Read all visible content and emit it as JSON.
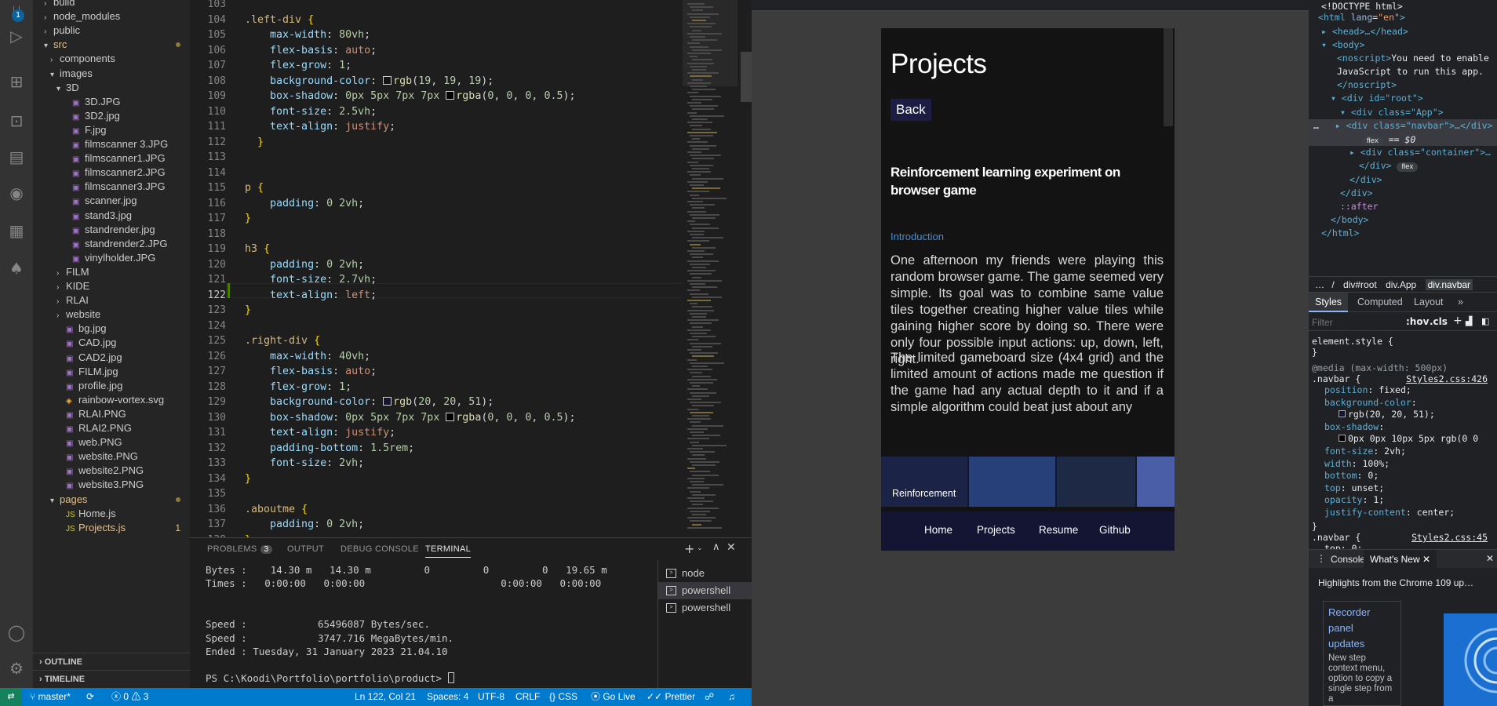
{
  "activity_bar": {
    "source_control_badge": "1",
    "icons": [
      "files-icon",
      "source-control-icon",
      "run-debug-icon",
      "extensions-icon",
      "remote-explorer-icon",
      "notebook-icon",
      "github-icon",
      "docker-icon",
      "mongodb-leaf-icon",
      "account-icon",
      "settings-gear-icon"
    ]
  },
  "explorer": {
    "items": [
      {
        "label": "build",
        "indent": 1,
        "type": "folder-closed"
      },
      {
        "label": "node_modules",
        "indent": 1,
        "type": "folder-closed"
      },
      {
        "label": "public",
        "indent": 1,
        "type": "folder-closed"
      },
      {
        "label": "src",
        "indent": 1,
        "type": "folder-open",
        "modified": true
      },
      {
        "label": "components",
        "indent": 2,
        "type": "folder-closed"
      },
      {
        "label": "images",
        "indent": 2,
        "type": "folder-open"
      },
      {
        "label": "3D",
        "indent": 3,
        "type": "folder-open"
      },
      {
        "label": "3D.JPG",
        "indent": 4,
        "type": "image"
      },
      {
        "label": "3D2.jpg",
        "indent": 4,
        "type": "image"
      },
      {
        "label": "F.jpg",
        "indent": 4,
        "type": "image"
      },
      {
        "label": "filmscanner 3.JPG",
        "indent": 4,
        "type": "image"
      },
      {
        "label": "filmscanner1.JPG",
        "indent": 4,
        "type": "image"
      },
      {
        "label": "filmscanner2.JPG",
        "indent": 4,
        "type": "image"
      },
      {
        "label": "filmscanner3.JPG",
        "indent": 4,
        "type": "image"
      },
      {
        "label": "scanner.jpg",
        "indent": 4,
        "type": "image"
      },
      {
        "label": "stand3.jpg",
        "indent": 4,
        "type": "image"
      },
      {
        "label": "standrender.jpg",
        "indent": 4,
        "type": "image"
      },
      {
        "label": "standrender2.JPG",
        "indent": 4,
        "type": "image"
      },
      {
        "label": "vinylholder.JPG",
        "indent": 4,
        "type": "image"
      },
      {
        "label": "FILM",
        "indent": 3,
        "type": "folder-closed"
      },
      {
        "label": "KIDE",
        "indent": 3,
        "type": "folder-closed"
      },
      {
        "label": "RLAI",
        "indent": 3,
        "type": "folder-closed"
      },
      {
        "label": "website",
        "indent": 3,
        "type": "folder-closed"
      },
      {
        "label": "bg.jpg",
        "indent": 3,
        "type": "image"
      },
      {
        "label": "CAD.jpg",
        "indent": 3,
        "type": "image"
      },
      {
        "label": "CAD2.jpg",
        "indent": 3,
        "type": "image"
      },
      {
        "label": "FILM.jpg",
        "indent": 3,
        "type": "image"
      },
      {
        "label": "profile.jpg",
        "indent": 3,
        "type": "image"
      },
      {
        "label": "rainbow-vortex.svg",
        "indent": 3,
        "type": "svg"
      },
      {
        "label": "RLAI.PNG",
        "indent": 3,
        "type": "image"
      },
      {
        "label": "RLAI2.PNG",
        "indent": 3,
        "type": "image"
      },
      {
        "label": "web.PNG",
        "indent": 3,
        "type": "image"
      },
      {
        "label": "website.PNG",
        "indent": 3,
        "type": "image"
      },
      {
        "label": "website2.PNG",
        "indent": 3,
        "type": "image"
      },
      {
        "label": "website3.PNG",
        "indent": 3,
        "type": "image"
      },
      {
        "label": "pages",
        "indent": 2,
        "type": "folder-open",
        "modified": true
      },
      {
        "label": "Home.js",
        "indent": 3,
        "type": "js"
      },
      {
        "label": "Projects.js",
        "indent": 3,
        "type": "js",
        "modified": true,
        "count": "1"
      }
    ],
    "outline_label": "OUTLINE",
    "timeline_label": "TIMELINE"
  },
  "editor": {
    "current_line": 122,
    "lines": [
      {
        "n": "103",
        "html": ""
      },
      {
        "n": "104",
        "html": "<span class='sel'>.left-div</span> <span class='brace'>{</span>"
      },
      {
        "n": "105",
        "html": "    <span class='prop'>max-width</span>: <span class='num'>80vh</span>;"
      },
      {
        "n": "106",
        "html": "    <span class='prop'>flex-basis</span>: <span class='val'>auto</span>;"
      },
      {
        "n": "107",
        "html": "    <span class='prop'>flex-grow</span>: <span class='num'>1</span>;"
      },
      {
        "n": "108",
        "html": "    <span class='prop'>background-color</span>: <span class='sw' style='background:#131313'></span><span class='fn'>rgb</span>(<span class='num'>19</span>, <span class='num'>19</span>, <span class='num'>19</span>);"
      },
      {
        "n": "109",
        "html": "    <span class='prop'>box-shadow</span>: <span class='num'>0px</span> <span class='num'>5px</span> <span class='num'>7px</span> <span class='num'>7px</span> <span class='sw' style='background:#000'></span><span class='fn'>rgba</span>(<span class='num'>0</span>, <span class='num'>0</span>, <span class='num'>0</span>, <span class='num'>0.5</span>);"
      },
      {
        "n": "110",
        "html": "    <span class='prop'>font-size</span>: <span class='num'>2.5vh</span>;"
      },
      {
        "n": "111",
        "html": "    <span class='prop'>text-align</span>: <span class='val'>justify</span>;"
      },
      {
        "n": "112",
        "html": "  <span class='brace'>}</span>"
      },
      {
        "n": "113",
        "html": ""
      },
      {
        "n": "114",
        "html": ""
      },
      {
        "n": "115",
        "html": "<span class='sel'>p</span> <span class='brace'>{</span>"
      },
      {
        "n": "116",
        "html": "    <span class='prop'>padding</span>: <span class='num'>0</span> <span class='num'>2vh</span>;"
      },
      {
        "n": "117",
        "html": "<span class='brace'>}</span>"
      },
      {
        "n": "118",
        "html": ""
      },
      {
        "n": "119",
        "html": "<span class='sel'>h3</span> <span class='brace'>{</span>"
      },
      {
        "n": "120",
        "html": "    <span class='prop'>padding</span>: <span class='num'>0</span> <span class='num'>2vh</span>;"
      },
      {
        "n": "121",
        "html": "    <span class='prop'>font-size</span>: <span class='num'>2.7vh</span>;"
      },
      {
        "n": "122",
        "html": "    <span class='prop'>text-align</span>: <span class='val'>left</span>;"
      },
      {
        "n": "123",
        "html": "<span class='brace'>}</span>"
      },
      {
        "n": "124",
        "html": ""
      },
      {
        "n": "125",
        "html": "<span class='sel'>.right-div</span> <span class='brace'>{</span>"
      },
      {
        "n": "126",
        "html": "    <span class='prop'>max-width</span>: <span class='num'>40vh</span>;"
      },
      {
        "n": "127",
        "html": "    <span class='prop'>flex-basis</span>: <span class='val'>auto</span>;"
      },
      {
        "n": "128",
        "html": "    <span class='prop'>flex-grow</span>: <span class='num'>1</span>;"
      },
      {
        "n": "129",
        "html": "    <span class='prop'>background-color</span>: <span class='sw' style='background:#141433'></span><span class='fn'>rgb</span>(<span class='num'>20</span>, <span class='num'>20</span>, <span class='num'>51</span>);"
      },
      {
        "n": "130",
        "html": "    <span class='prop'>box-shadow</span>: <span class='num'>0px</span> <span class='num'>5px</span> <span class='num'>7px</span> <span class='num'>7px</span> <span class='sw' style='background:#000'></span><span class='fn'>rgba</span>(<span class='num'>0</span>, <span class='num'>0</span>, <span class='num'>0</span>, <span class='num'>0.5</span>);"
      },
      {
        "n": "131",
        "html": "    <span class='prop'>text-align</span>: <span class='val'>justify</span>;"
      },
      {
        "n": "132",
        "html": "    <span class='prop'>padding-bottom</span>: <span class='num'>1.5rem</span>;"
      },
      {
        "n": "133",
        "html": "    <span class='prop'>font-size</span>: <span class='num'>2vh</span>;"
      },
      {
        "n": "134",
        "html": "<span class='brace'>}</span>"
      },
      {
        "n": "135",
        "html": ""
      },
      {
        "n": "136",
        "html": "<span class='sel'>.aboutme</span> <span class='brace'>{</span>"
      },
      {
        "n": "137",
        "html": "    <span class='prop'>padding</span>: <span class='num'>0</span> <span class='num'>2vh</span>;"
      },
      {
        "n": "138",
        "html": "<span class='brace'>}</span>"
      }
    ]
  },
  "panel": {
    "tabs": {
      "problems": "PROBLEMS",
      "problems_count": "3",
      "output": "OUTPUT",
      "debug": "DEBUG CONSOLE",
      "terminal": "TERMINAL"
    },
    "terminal_lines": [
      "Bytes :    14.30 m   14.30 m         0         0         0   19.65 m",
      "Times :   0:00:00   0:00:00                       0:00:00   0:00:00",
      "",
      "",
      "Speed :            65496087 Bytes/sec.",
      "Speed :            3747.716 MegaBytes/min.",
      "Ended : Tuesday, 31 January 2023 21.04.10",
      "",
      "PS C:\\Koodi\\Portfolio\\portfolio\\product> "
    ],
    "terminals": [
      "node",
      "powershell",
      "powershell"
    ]
  },
  "status_bar": {
    "branch": "master*",
    "errors": "0",
    "warnings": "3",
    "position": "Ln 122, Col 21",
    "spaces": "Spaces: 4",
    "encoding": "UTF-8",
    "eol": "CRLF",
    "language": "CSS",
    "golive": "Go Live",
    "prettier": "Prettier"
  },
  "preview": {
    "page_title": "Projects",
    "back_button": "Back",
    "project_title": "Reinforcement learning experiment on browser game",
    "section": "Introduction",
    "paragraphs": [
      "One afternoon my friends were playing this random browser game. The game seemed very simple. Its goal was to combine same value tiles together creating higher value tiles while gaining higher score by doing so. There were only four possible input actions: up, down, left, right.",
      "The limited gameboard size (4x4 grid) and the limited amount of actions made me question if the game had any actual depth to it and if a simple algorithm could beat just about any"
    ],
    "thumb_caption": "Reinforcement",
    "nav": [
      "Home",
      "Projects",
      "Resume",
      "Github"
    ],
    "colors": {
      "page_bg": "#131313",
      "nav_bg": "#141433",
      "link": "#3f8fdf"
    }
  },
  "devtools": {
    "dom": {
      "doctype": "<!DOCTYPE html>",
      "html_open": "html",
      "lang_attr": "lang",
      "lang_val": "\"en\"",
      "head": "<head>…</head>",
      "body_open": "<body>",
      "noscript_text": "You need to enable JavaScript to run this app.",
      "noscript_close": "</noscript>",
      "root": "<div id=\"root\">",
      "app": "<div class=\"App\">",
      "navbar": "<div class=\"navbar\">…</div>",
      "flex_pill": "flex",
      "dollar0": "== $0",
      "container": "<div class=\"container\">…",
      "div_close": "</div>",
      "after": "::after",
      "body_close": "</body>",
      "html_close": "</html>"
    },
    "breadcrumbs": [
      "…",
      "/",
      "div#root",
      "div.App",
      "div.navbar"
    ],
    "style_tabs": [
      "Styles",
      "Computed",
      "Layout",
      "»"
    ],
    "filter_placeholder": "Filter",
    "hov": ":hov",
    ".cls": ".cls",
    "element_style": "element.style {",
    "close_brace": "}",
    "media": "@media (max-width: 500px)",
    "navbar_sel": ".navbar {",
    "source1": "Styles2.css:426",
    "source2": "Styles2.css:45",
    "rules": [
      {
        "p": "position",
        "v": "fixed;"
      },
      {
        "p": "background-color",
        "v": ""
      },
      {
        "p": "",
        "v": "rgb(20, 20, 51);"
      },
      {
        "p": "box-shadow",
        "v": ""
      },
      {
        "p": "",
        "v": "0px 0px 10px 5px rgb(0 0"
      },
      {
        "p": "font-size",
        "v": "2vh;"
      },
      {
        "p": "width",
        "v": "100%;"
      },
      {
        "p": "bottom",
        "v": "0;"
      },
      {
        "p": "top",
        "v": "unset;"
      },
      {
        "p": "opacity",
        "v": "1;"
      },
      {
        "p": "justify-content",
        "v": "center;"
      }
    ],
    "partial_rule": "top: 0;",
    "drawer_tabs": [
      "Console",
      "What's New"
    ],
    "whatsnew_heading": "Highlights from the Chrome 109 up…",
    "card_title": "Recorder panel updates",
    "card_text": "New step context menu, option to copy a single step from a"
  }
}
